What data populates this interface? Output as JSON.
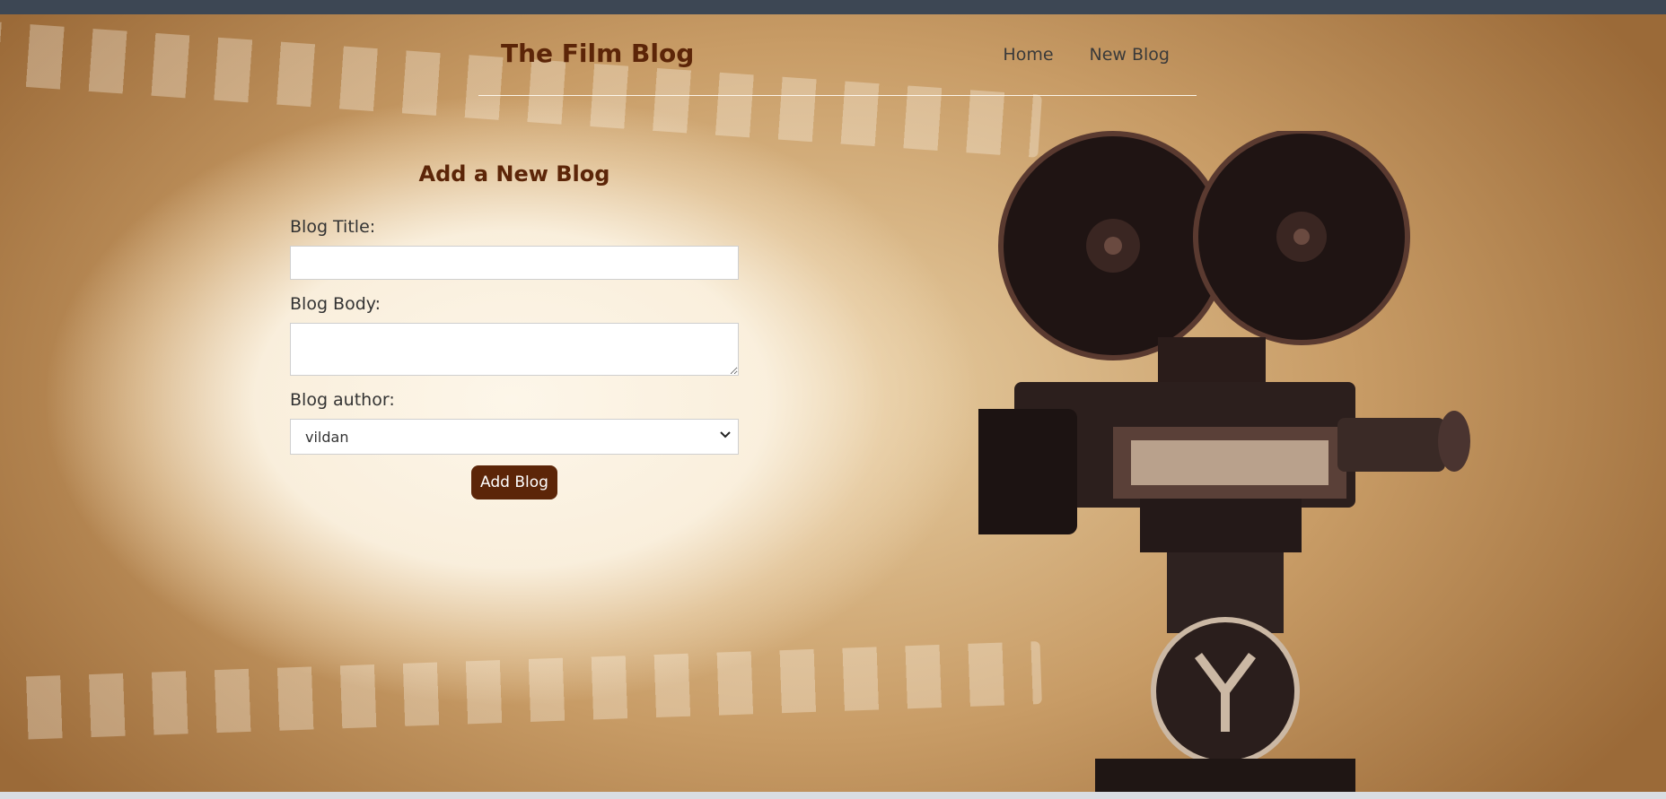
{
  "header": {
    "brand": "The Film Blog",
    "nav": [
      {
        "label": "Home"
      },
      {
        "label": "New Blog"
      }
    ]
  },
  "form": {
    "title": "Add a New Blog",
    "title_label": "Blog Title:",
    "title_value": "",
    "body_label": "Blog Body:",
    "body_value": "",
    "author_label": "Blog author:",
    "author_selected": "vildan",
    "submit_label": "Add Blog"
  },
  "colors": {
    "brand": "#5c2508",
    "button_bg": "#5c2508",
    "background": "#c89c66"
  }
}
